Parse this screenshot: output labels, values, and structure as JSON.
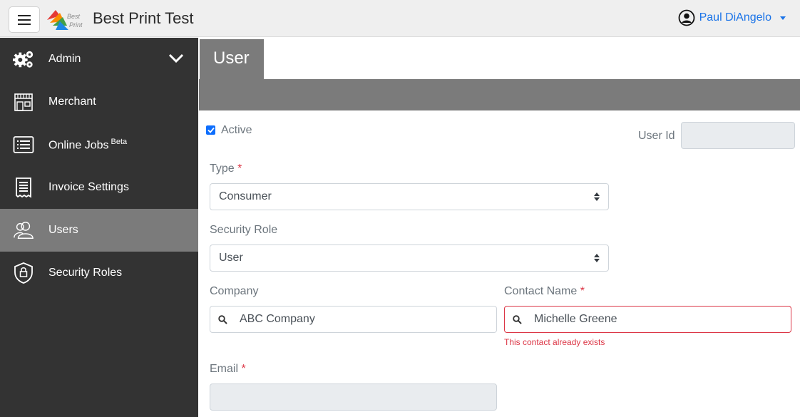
{
  "header": {
    "app_title": "Best Print Test",
    "logo_text_1": "Best",
    "logo_text_2": "Print",
    "user_name": "Paul DiAngelo"
  },
  "sidebar": {
    "items": [
      {
        "label": "Admin",
        "icon": "gears-icon"
      },
      {
        "label": "Merchant",
        "icon": "storefront-icon"
      },
      {
        "label": "Online Jobs",
        "sup": "Beta",
        "icon": "list-icon"
      },
      {
        "label": "Invoice Settings",
        "icon": "receipt-icon"
      },
      {
        "label": "Users",
        "icon": "users-icon",
        "active": true
      },
      {
        "label": "Security Roles",
        "icon": "shield-lock-icon"
      }
    ]
  },
  "page": {
    "title": "User"
  },
  "form": {
    "active_label": "Active",
    "active_checked": true,
    "user_id_label": "User Id",
    "user_id_value": "",
    "type_label": "Type",
    "type_value": "Consumer",
    "security_role_label": "Security Role",
    "security_role_value": "User",
    "company_label": "Company",
    "company_value": "ABC Company",
    "contact_label": "Contact Name",
    "contact_value": "Michelle Greene",
    "contact_error": "This contact already exists",
    "email_label": "Email",
    "email_value": "",
    "required_mark": "*"
  },
  "colors": {
    "sidebar_bg": "#333333",
    "active_item_bg": "#7b7b7b",
    "accent": "#1a73e8",
    "error": "#dc3545"
  }
}
